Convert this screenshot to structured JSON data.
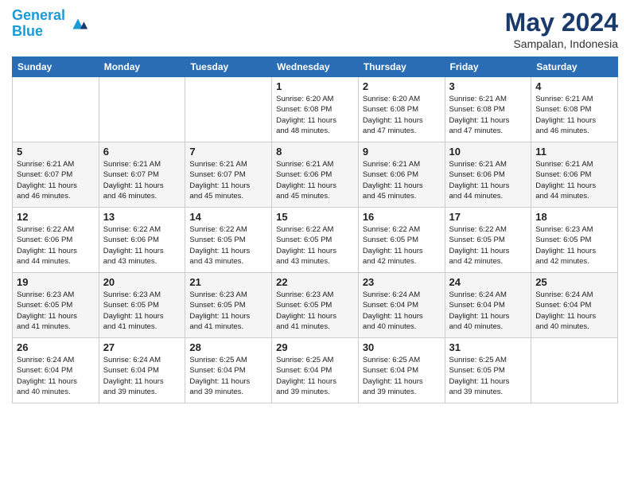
{
  "header": {
    "logo_line1": "General",
    "logo_line2": "Blue",
    "month_title": "May 2024",
    "location": "Sampalan, Indonesia"
  },
  "weekdays": [
    "Sunday",
    "Monday",
    "Tuesday",
    "Wednesday",
    "Thursday",
    "Friday",
    "Saturday"
  ],
  "weeks": [
    [
      {
        "day": "",
        "info": ""
      },
      {
        "day": "",
        "info": ""
      },
      {
        "day": "",
        "info": ""
      },
      {
        "day": "1",
        "info": "Sunrise: 6:20 AM\nSunset: 6:08 PM\nDaylight: 11 hours\nand 48 minutes."
      },
      {
        "day": "2",
        "info": "Sunrise: 6:20 AM\nSunset: 6:08 PM\nDaylight: 11 hours\nand 47 minutes."
      },
      {
        "day": "3",
        "info": "Sunrise: 6:21 AM\nSunset: 6:08 PM\nDaylight: 11 hours\nand 47 minutes."
      },
      {
        "day": "4",
        "info": "Sunrise: 6:21 AM\nSunset: 6:08 PM\nDaylight: 11 hours\nand 46 minutes."
      }
    ],
    [
      {
        "day": "5",
        "info": "Sunrise: 6:21 AM\nSunset: 6:07 PM\nDaylight: 11 hours\nand 46 minutes."
      },
      {
        "day": "6",
        "info": "Sunrise: 6:21 AM\nSunset: 6:07 PM\nDaylight: 11 hours\nand 46 minutes."
      },
      {
        "day": "7",
        "info": "Sunrise: 6:21 AM\nSunset: 6:07 PM\nDaylight: 11 hours\nand 45 minutes."
      },
      {
        "day": "8",
        "info": "Sunrise: 6:21 AM\nSunset: 6:06 PM\nDaylight: 11 hours\nand 45 minutes."
      },
      {
        "day": "9",
        "info": "Sunrise: 6:21 AM\nSunset: 6:06 PM\nDaylight: 11 hours\nand 45 minutes."
      },
      {
        "day": "10",
        "info": "Sunrise: 6:21 AM\nSunset: 6:06 PM\nDaylight: 11 hours\nand 44 minutes."
      },
      {
        "day": "11",
        "info": "Sunrise: 6:21 AM\nSunset: 6:06 PM\nDaylight: 11 hours\nand 44 minutes."
      }
    ],
    [
      {
        "day": "12",
        "info": "Sunrise: 6:22 AM\nSunset: 6:06 PM\nDaylight: 11 hours\nand 44 minutes."
      },
      {
        "day": "13",
        "info": "Sunrise: 6:22 AM\nSunset: 6:06 PM\nDaylight: 11 hours\nand 43 minutes."
      },
      {
        "day": "14",
        "info": "Sunrise: 6:22 AM\nSunset: 6:05 PM\nDaylight: 11 hours\nand 43 minutes."
      },
      {
        "day": "15",
        "info": "Sunrise: 6:22 AM\nSunset: 6:05 PM\nDaylight: 11 hours\nand 43 minutes."
      },
      {
        "day": "16",
        "info": "Sunrise: 6:22 AM\nSunset: 6:05 PM\nDaylight: 11 hours\nand 42 minutes."
      },
      {
        "day": "17",
        "info": "Sunrise: 6:22 AM\nSunset: 6:05 PM\nDaylight: 11 hours\nand 42 minutes."
      },
      {
        "day": "18",
        "info": "Sunrise: 6:23 AM\nSunset: 6:05 PM\nDaylight: 11 hours\nand 42 minutes."
      }
    ],
    [
      {
        "day": "19",
        "info": "Sunrise: 6:23 AM\nSunset: 6:05 PM\nDaylight: 11 hours\nand 41 minutes."
      },
      {
        "day": "20",
        "info": "Sunrise: 6:23 AM\nSunset: 6:05 PM\nDaylight: 11 hours\nand 41 minutes."
      },
      {
        "day": "21",
        "info": "Sunrise: 6:23 AM\nSunset: 6:05 PM\nDaylight: 11 hours\nand 41 minutes."
      },
      {
        "day": "22",
        "info": "Sunrise: 6:23 AM\nSunset: 6:05 PM\nDaylight: 11 hours\nand 41 minutes."
      },
      {
        "day": "23",
        "info": "Sunrise: 6:24 AM\nSunset: 6:04 PM\nDaylight: 11 hours\nand 40 minutes."
      },
      {
        "day": "24",
        "info": "Sunrise: 6:24 AM\nSunset: 6:04 PM\nDaylight: 11 hours\nand 40 minutes."
      },
      {
        "day": "25",
        "info": "Sunrise: 6:24 AM\nSunset: 6:04 PM\nDaylight: 11 hours\nand 40 minutes."
      }
    ],
    [
      {
        "day": "26",
        "info": "Sunrise: 6:24 AM\nSunset: 6:04 PM\nDaylight: 11 hours\nand 40 minutes."
      },
      {
        "day": "27",
        "info": "Sunrise: 6:24 AM\nSunset: 6:04 PM\nDaylight: 11 hours\nand 39 minutes."
      },
      {
        "day": "28",
        "info": "Sunrise: 6:25 AM\nSunset: 6:04 PM\nDaylight: 11 hours\nand 39 minutes."
      },
      {
        "day": "29",
        "info": "Sunrise: 6:25 AM\nSunset: 6:04 PM\nDaylight: 11 hours\nand 39 minutes."
      },
      {
        "day": "30",
        "info": "Sunrise: 6:25 AM\nSunset: 6:04 PM\nDaylight: 11 hours\nand 39 minutes."
      },
      {
        "day": "31",
        "info": "Sunrise: 6:25 AM\nSunset: 6:05 PM\nDaylight: 11 hours\nand 39 minutes."
      },
      {
        "day": "",
        "info": ""
      }
    ]
  ]
}
